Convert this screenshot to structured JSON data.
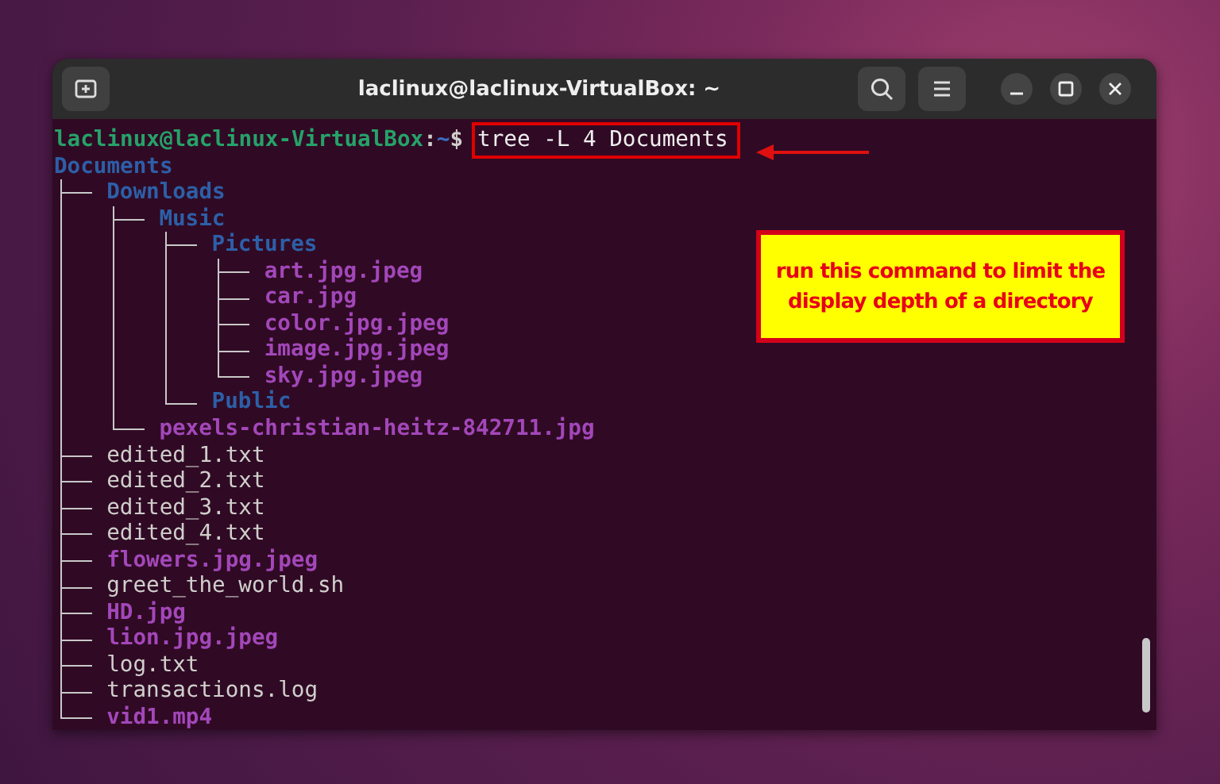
{
  "window": {
    "title": "laclinux@laclinux-VirtualBox: ~"
  },
  "prompt": {
    "user_host": "laclinux@laclinux-VirtualBox",
    "separator": ":",
    "path": "~",
    "symbol": "$",
    "command": "tree -L 4 Documents"
  },
  "tree": {
    "name": "Documents",
    "kind": "dir",
    "children": [
      {
        "name": "Downloads",
        "kind": "dir",
        "children": [
          {
            "name": "Music",
            "kind": "dir",
            "children": [
              {
                "name": "Pictures",
                "kind": "dir",
                "children": [
                  {
                    "name": "art.jpg.jpeg",
                    "kind": "image"
                  },
                  {
                    "name": "car.jpg",
                    "kind": "image"
                  },
                  {
                    "name": "color.jpg.jpeg",
                    "kind": "image"
                  },
                  {
                    "name": "image.jpg.jpeg",
                    "kind": "image"
                  },
                  {
                    "name": "sky.jpg.jpeg",
                    "kind": "image"
                  }
                ]
              },
              {
                "name": "Public",
                "kind": "dir"
              }
            ]
          },
          {
            "name": "pexels-christian-heitz-842711.jpg",
            "kind": "image"
          }
        ]
      },
      {
        "name": "edited_1.txt",
        "kind": "file"
      },
      {
        "name": "edited_2.txt",
        "kind": "file"
      },
      {
        "name": "edited_3.txt",
        "kind": "file"
      },
      {
        "name": "edited_4.txt",
        "kind": "file"
      },
      {
        "name": "flowers.jpg.jpeg",
        "kind": "image"
      },
      {
        "name": "greet_the_world.sh",
        "kind": "file"
      },
      {
        "name": "HD.jpg",
        "kind": "image"
      },
      {
        "name": "lion.jpg.jpeg",
        "kind": "image"
      },
      {
        "name": "log.txt",
        "kind": "file"
      },
      {
        "name": "transactions.log",
        "kind": "file"
      },
      {
        "name": "vid1.mp4",
        "kind": "image"
      }
    ]
  },
  "annotation": {
    "text": "run this command to limit the display depth of a directory"
  }
}
